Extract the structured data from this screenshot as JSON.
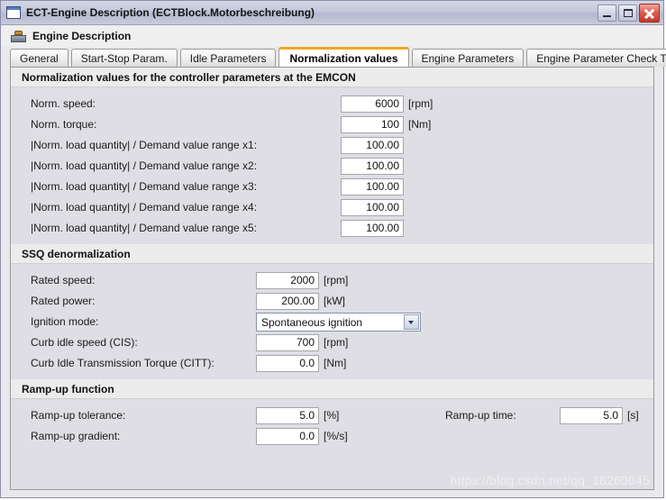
{
  "window": {
    "title": "ECT-Engine Description (ECTBlock.Motorbeschreibung)",
    "icon": "window-icon",
    "buttons": {
      "minimize": "_",
      "maximize": "□",
      "close": "✕"
    }
  },
  "header": {
    "title": "Engine Description",
    "icon": "engine-icon"
  },
  "tabs": [
    {
      "label": "General",
      "active": false
    },
    {
      "label": "Start-Stop Param.",
      "active": false
    },
    {
      "label": "Idle Parameters",
      "active": false
    },
    {
      "label": "Normalization values",
      "active": true
    },
    {
      "label": "Engine Parameters",
      "active": false
    },
    {
      "label": "Engine Parameter Check Table",
      "active": false
    }
  ],
  "sections": [
    {
      "title": "Normalization values for the controller parameters at the EMCON",
      "rows": [
        {
          "label": "Norm. speed:",
          "value": "6000",
          "unit": "[rpm]",
          "type": "text"
        },
        {
          "label": "Norm. torque:",
          "value": "100",
          "unit": "[Nm]",
          "type": "text"
        },
        {
          "label": "|Norm. load quantity| / Demand value range x1:",
          "value": "100.00",
          "unit": "",
          "type": "text"
        },
        {
          "label": "|Norm. load quantity| / Demand value range x2:",
          "value": "100.00",
          "unit": "",
          "type": "text"
        },
        {
          "label": "|Norm. load quantity| / Demand value range x3:",
          "value": "100.00",
          "unit": "",
          "type": "text"
        },
        {
          "label": "|Norm. load quantity| / Demand value range x4:",
          "value": "100.00",
          "unit": "",
          "type": "text"
        },
        {
          "label": "|Norm. load quantity| / Demand value range x5:",
          "value": "100.00",
          "unit": "",
          "type": "text"
        }
      ]
    },
    {
      "title": "SSQ denormalization",
      "rows": [
        {
          "label": "Rated speed:",
          "value": "2000",
          "unit": "[rpm]",
          "type": "text"
        },
        {
          "label": "Rated power:",
          "value": "200.00",
          "unit": "[kW]",
          "type": "text"
        },
        {
          "label": "Ignition mode:",
          "value": "Spontaneous ignition",
          "unit": "",
          "type": "combo"
        },
        {
          "label": "Curb idle speed (CIS):",
          "value": "700",
          "unit": "[rpm]",
          "type": "text"
        },
        {
          "label": "Curb Idle Transmission Torque (CITT):",
          "value": "0.0",
          "unit": "[Nm]",
          "type": "text"
        }
      ]
    },
    {
      "title": "Ramp-up function",
      "rows": [
        {
          "label": "Ramp-up tolerance:",
          "value": "5.0",
          "unit": "[%]",
          "type": "text",
          "label2": "Ramp-up time:",
          "value2": "5.0",
          "unit2": "[s]"
        },
        {
          "label": "Ramp-up gradient:",
          "value": "0.0",
          "unit": "[%/s]",
          "type": "text"
        }
      ]
    }
  ],
  "watermark": "https://blog.csdn.net/qq_18260845",
  "colors": {
    "titlebar": "#c2c7da",
    "panel_bg": "#dedee4",
    "section_head": "#ececec",
    "active_tab_accent": "#f0a71e",
    "close_button": "#c23a2a"
  }
}
